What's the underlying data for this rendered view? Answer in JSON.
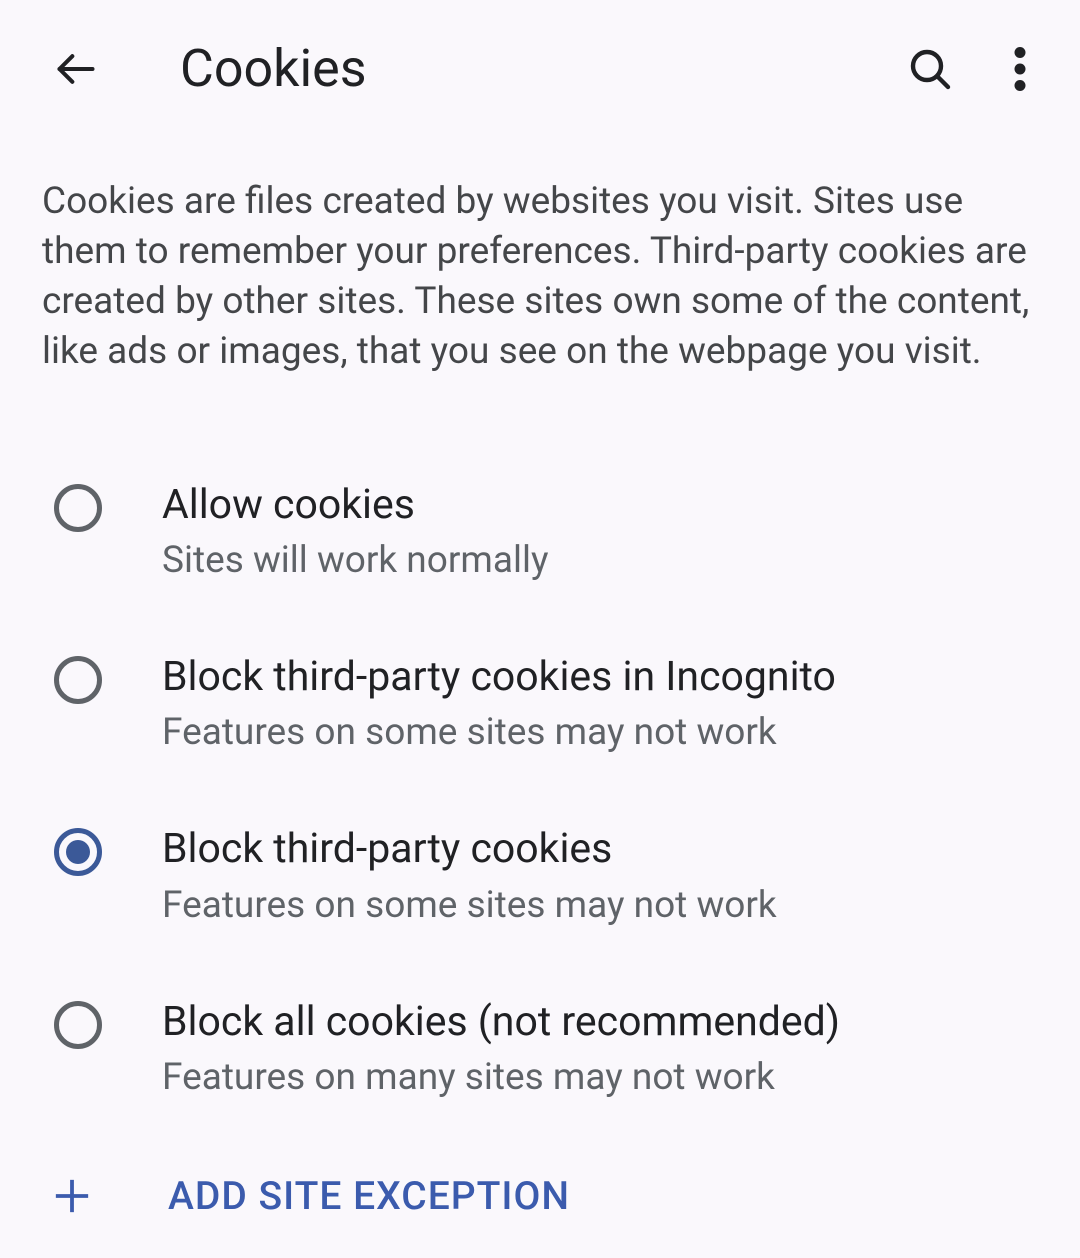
{
  "header": {
    "title": "Cookies"
  },
  "description": "Cookies are files created by websites you visit. Sites use them to remember your preferences. Third-party cookies are created by other sites. These sites own some of the content, like ads or images, that you see on the webpage you visit.",
  "options": [
    {
      "title": "Allow cookies",
      "subtitle": "Sites will work normally",
      "selected": false
    },
    {
      "title": "Block third-party cookies in Incognito",
      "subtitle": "Features on some sites may not work",
      "selected": false
    },
    {
      "title": "Block third-party cookies",
      "subtitle": "Features on some sites may not work",
      "selected": true
    },
    {
      "title": "Block all cookies (not recommended)",
      "subtitle": "Features on many sites may not work",
      "selected": false
    }
  ],
  "addException": {
    "label": "ADD SITE EXCEPTION"
  }
}
